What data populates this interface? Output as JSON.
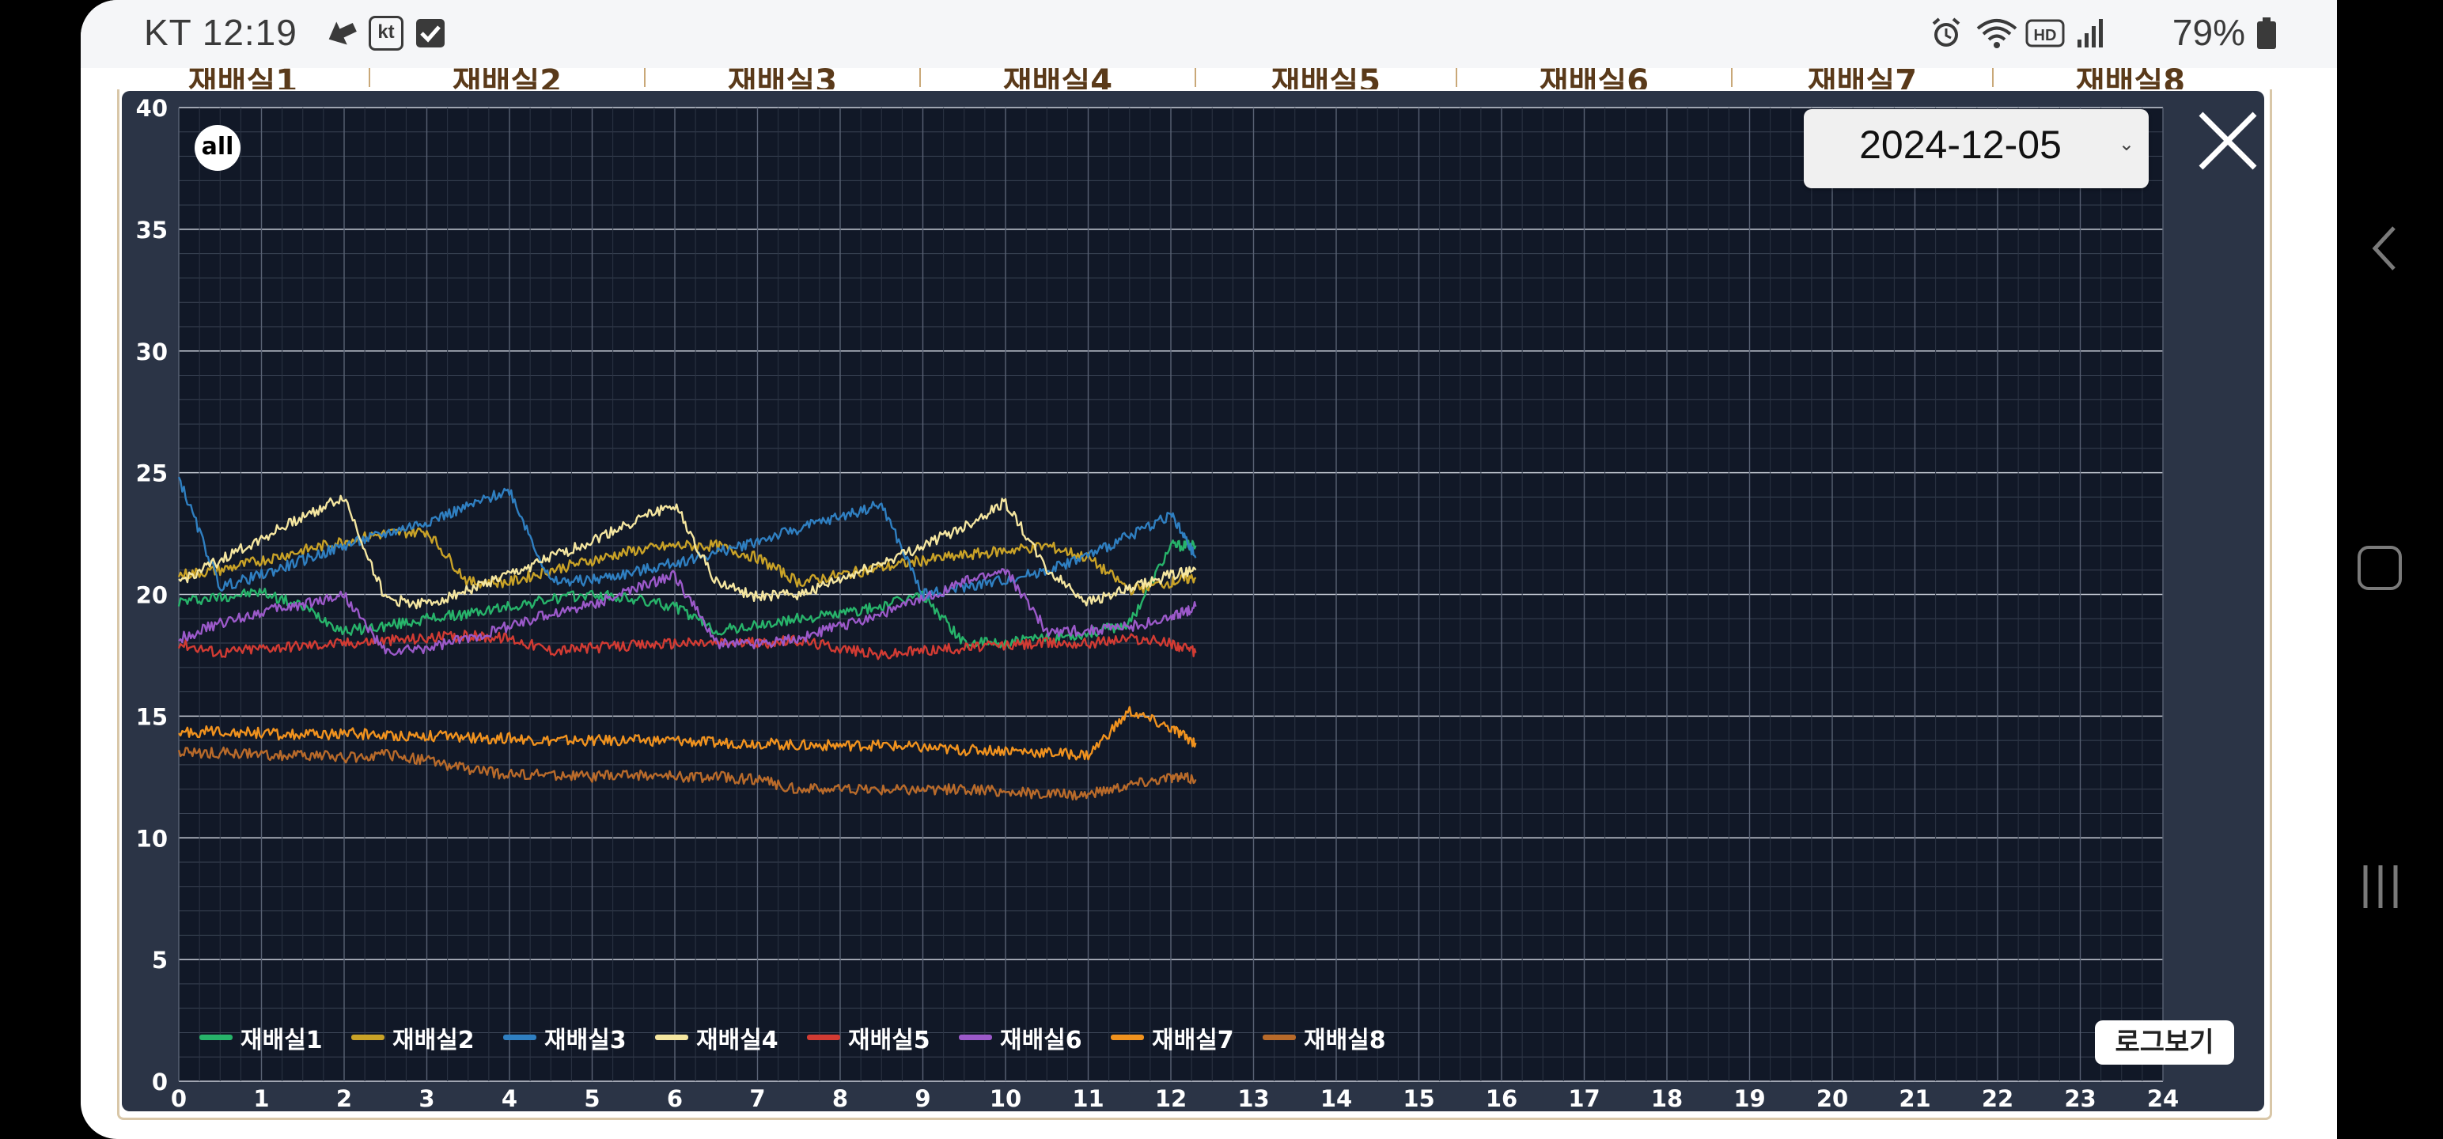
{
  "status_bar": {
    "carrier_time": "KT 12:19",
    "kt_badge": "kt",
    "battery": "79%",
    "icons": [
      "navigation-arrow-icon",
      "kt-badge-icon",
      "check-box-icon",
      "alarm-icon",
      "wifi-icon",
      "hd-icon",
      "signal-icon",
      "battery-icon"
    ]
  },
  "tabs": [
    "재배실1",
    "재배실2",
    "재배실3",
    "재배실4",
    "재배실5",
    "재배실6",
    "재배실7",
    "재배실8"
  ],
  "controls": {
    "all_label": "all",
    "date_value": "2024-12-05",
    "close_icon": "close-icon",
    "log_button": "로그보기"
  },
  "colors": {
    "chart_bg": "#111827",
    "chart_border": "#2b3446",
    "series": [
      "#27b36a",
      "#c9a227",
      "#2f7fc1",
      "#f5e6a0",
      "#d23b33",
      "#9b59c9",
      "#f0921e",
      "#b86a2a"
    ]
  },
  "chart_data": {
    "type": "line",
    "ylim": [
      0,
      40
    ],
    "yticks": [
      0,
      5,
      10,
      15,
      20,
      25,
      30,
      35,
      40
    ],
    "xlim": [
      0,
      24
    ],
    "xticks": [
      0,
      1,
      2,
      3,
      4,
      5,
      6,
      7,
      8,
      9,
      10,
      11,
      12,
      13,
      14,
      15,
      16,
      17,
      18,
      19,
      20,
      21,
      22,
      23,
      24
    ],
    "x": [
      0,
      0.5,
      1,
      1.5,
      2,
      2.5,
      3,
      3.5,
      4,
      4.5,
      5,
      5.5,
      6,
      6.5,
      7,
      7.5,
      8,
      8.5,
      9,
      9.5,
      10,
      10.5,
      11,
      11.5,
      12,
      12.3
    ],
    "series": [
      {
        "name": "재배실1",
        "values": [
          19.7,
          19.9,
          20.1,
          19.5,
          18.5,
          18.7,
          19.0,
          19.2,
          19.5,
          19.8,
          20.0,
          19.8,
          19.5,
          18.5,
          18.7,
          19.0,
          19.2,
          19.5,
          20.0,
          18.0,
          18.0,
          18.2,
          18.4,
          18.8,
          22.0,
          22.0
        ]
      },
      {
        "name": "재배실2",
        "values": [
          20.8,
          21.0,
          21.4,
          21.8,
          22.2,
          22.5,
          22.6,
          20.5,
          20.5,
          21.0,
          21.4,
          21.8,
          22.0,
          22.0,
          21.5,
          20.5,
          20.8,
          21.1,
          21.4,
          21.6,
          21.8,
          22.0,
          21.5,
          20.2,
          20.5,
          20.7
        ]
      },
      {
        "name": "재배실3",
        "values": [
          24.8,
          20.3,
          20.8,
          21.4,
          22.0,
          22.5,
          23.0,
          23.6,
          24.3,
          20.5,
          20.6,
          20.9,
          21.3,
          21.7,
          22.2,
          22.7,
          23.2,
          23.7,
          20.0,
          20.3,
          20.6,
          21.0,
          21.6,
          22.4,
          23.3,
          21.5
        ]
      },
      {
        "name": "재배실4",
        "values": [
          20.5,
          21.4,
          22.3,
          23.2,
          24.0,
          19.8,
          19.6,
          20.2,
          20.8,
          21.5,
          22.2,
          23.0,
          23.7,
          20.5,
          19.9,
          20.0,
          20.6,
          21.3,
          22.0,
          22.8,
          23.8,
          21.0,
          19.7,
          20.2,
          20.8,
          21.0
        ]
      },
      {
        "name": "재배실5",
        "values": [
          18.0,
          17.6,
          17.8,
          17.9,
          18.0,
          18.1,
          18.2,
          18.3,
          18.2,
          17.7,
          17.8,
          17.9,
          18.0,
          18.0,
          18.0,
          18.1,
          17.8,
          17.5,
          17.7,
          17.8,
          17.9,
          18.0,
          18.0,
          18.2,
          18.0,
          17.6
        ]
      },
      {
        "name": "재배실6",
        "values": [
          18.2,
          18.8,
          19.3,
          19.6,
          20.0,
          17.6,
          17.8,
          18.2,
          18.7,
          19.2,
          19.6,
          20.2,
          20.8,
          18.0,
          18.0,
          18.2,
          18.7,
          19.2,
          19.8,
          20.5,
          21.0,
          18.5,
          18.5,
          18.7,
          19.0,
          19.5
        ]
      },
      {
        "name": "재배실7",
        "values": [
          14.3,
          14.4,
          14.3,
          14.2,
          14.3,
          14.2,
          14.2,
          14.1,
          14.1,
          14.0,
          14.0,
          14.0,
          14.0,
          13.9,
          13.9,
          13.8,
          13.8,
          13.8,
          13.7,
          13.6,
          13.6,
          13.5,
          13.4,
          15.2,
          14.5,
          13.9
        ]
      },
      {
        "name": "재배실8",
        "values": [
          13.5,
          13.5,
          13.4,
          13.4,
          13.3,
          13.4,
          13.2,
          12.8,
          12.6,
          12.6,
          12.5,
          12.6,
          12.5,
          12.5,
          12.4,
          12.0,
          12.0,
          12.0,
          12.0,
          12.0,
          11.9,
          11.8,
          11.8,
          12.2,
          12.5,
          12.4
        ]
      }
    ]
  }
}
